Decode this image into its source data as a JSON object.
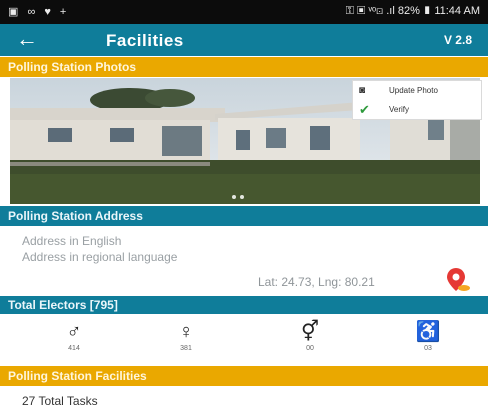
{
  "status_bar": {
    "left_icons": "▣ ∞ ♥ +",
    "right": "⚿ ▣ ᵛᵒ⊡ .ıl 82% ▮ 11:44 AM"
  },
  "app_bar": {
    "back_icon": "back-arrow-icon",
    "title": "Facilities",
    "version": "V 2.8"
  },
  "photos": {
    "header": "Polling Station Photos",
    "menu": [
      {
        "icon": "camera-icon",
        "label": "Update Photo"
      },
      {
        "icon": "check-icon",
        "label": "Verify"
      }
    ],
    "dots": 2
  },
  "address": {
    "header": "Polling Station Address",
    "english": "Address in English",
    "regional": "Address in regional language",
    "latlng": "Lat: 24.73, Lng: 80.21"
  },
  "electors": {
    "header": "Total Electors [795]",
    "items": [
      {
        "icon": "male-icon",
        "count": "414"
      },
      {
        "icon": "female-icon",
        "count": "381"
      },
      {
        "icon": "third-gender-icon",
        "count": "00"
      },
      {
        "icon": "disabled-icon",
        "count": "03"
      }
    ]
  },
  "facilities": {
    "header": "Polling Station Facilities",
    "tasks": "27 Total Tasks"
  },
  "colors": {
    "primary": "#0f7d9a",
    "accent": "#eaa800",
    "pin_red": "#e53935",
    "check_green": "#2e9a3c"
  }
}
